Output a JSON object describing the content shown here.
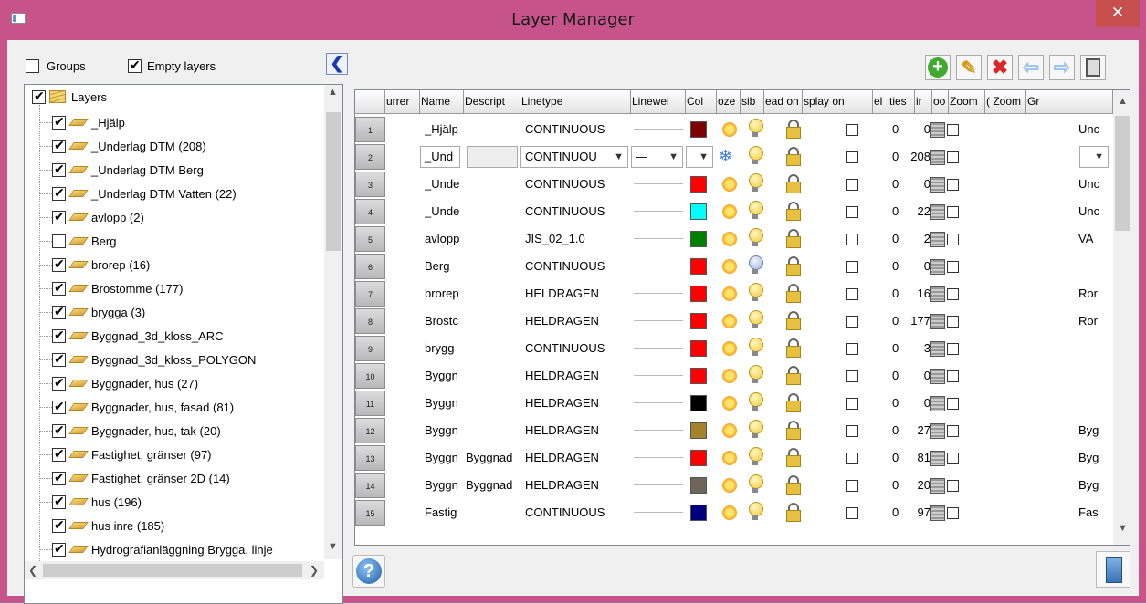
{
  "window": {
    "title": "Layer Manager",
    "close_label": "✕"
  },
  "options": {
    "groups_label": "Groups",
    "groups_checked": false,
    "empty_label": "Empty layers",
    "empty_checked": true,
    "collapse_label": "❮"
  },
  "tree": {
    "root_label": "Layers",
    "items": [
      {
        "label": "_Hjälp",
        "checked": true
      },
      {
        "label": "_Underlag DTM (208)",
        "checked": true
      },
      {
        "label": "_Underlag DTM Berg",
        "checked": true
      },
      {
        "label": "_Underlag DTM Vatten (22)",
        "checked": true
      },
      {
        "label": "avlopp (2)",
        "checked": true
      },
      {
        "label": "Berg",
        "checked": false
      },
      {
        "label": "brorep (16)",
        "checked": true
      },
      {
        "label": "Brostomme (177)",
        "checked": true
      },
      {
        "label": "brygga (3)",
        "checked": true
      },
      {
        "label": "Byggnad_3d_kloss_ARC",
        "checked": true
      },
      {
        "label": "Byggnad_3d_kloss_POLYGON",
        "checked": true
      },
      {
        "label": "Byggnader, hus (27)",
        "checked": true
      },
      {
        "label": "Byggnader, hus, fasad (81)",
        "checked": true
      },
      {
        "label": "Byggnader, hus, tak (20)",
        "checked": true
      },
      {
        "label": "Fastighet, gränser (97)",
        "checked": true
      },
      {
        "label": "Fastighet, gränser 2D (14)",
        "checked": true
      },
      {
        "label": "hus (196)",
        "checked": true
      },
      {
        "label": "hus inre (185)",
        "checked": true
      },
      {
        "label": "Hydrografianläggning Brygga, linje",
        "checked": true
      }
    ]
  },
  "toolbar": {
    "add": "add-layer",
    "edit": "edit-layer",
    "delete": "delete-layer",
    "prev": "previous",
    "next": "next",
    "close": "close-panel"
  },
  "grid": {
    "headers": [
      "urrer",
      "Name",
      "Descript",
      "Linetype",
      "Linewei",
      "Col",
      "oze",
      "sib",
      "ead on",
      "splay on",
      "el",
      "ties",
      "ir",
      "oo",
      "Zoom",
      "( Zoom",
      "Gr"
    ],
    "rows": [
      {
        "num": "1",
        "name": "_Hjälp",
        "desc": "",
        "linetype": "CONTINUOUS",
        "color": "#7f0000",
        "frozen": false,
        "visible": true,
        "elev": "0",
        "count": "0",
        "group": "Unc"
      },
      {
        "num": "2",
        "name": "_Und",
        "desc": "",
        "linetype": "CONTINUOU",
        "color": "",
        "frozen": true,
        "visible": true,
        "elev": "0",
        "count": "208",
        "group": "",
        "editing": true
      },
      {
        "num": "3",
        "name": "_Unde",
        "desc": "",
        "linetype": "CONTINUOUS",
        "color": "#ff0000",
        "frozen": false,
        "visible": true,
        "elev": "0",
        "count": "0",
        "group": "Unc"
      },
      {
        "num": "4",
        "name": "_Unde",
        "desc": "",
        "linetype": "CONTINUOUS",
        "color": "#00ffff",
        "frozen": false,
        "visible": true,
        "elev": "0",
        "count": "22",
        "group": "Unc"
      },
      {
        "num": "5",
        "name": "avlopp",
        "desc": "",
        "linetype": "JIS_02_1.0",
        "color": "#008000",
        "frozen": false,
        "visible": true,
        "elev": "0",
        "count": "2",
        "group": "VA"
      },
      {
        "num": "6",
        "name": "Berg",
        "desc": "",
        "linetype": "CONTINUOUS",
        "color": "#ff0000",
        "frozen": false,
        "visible": false,
        "elev": "0",
        "count": "0",
        "group": ""
      },
      {
        "num": "7",
        "name": "brorep",
        "desc": "",
        "linetype": "HELDRAGEN",
        "color": "#ff0000",
        "frozen": false,
        "visible": true,
        "elev": "0",
        "count": "16",
        "group": "Ror"
      },
      {
        "num": "8",
        "name": "Brostc",
        "desc": "",
        "linetype": "HELDRAGEN",
        "color": "#ff0000",
        "frozen": false,
        "visible": true,
        "elev": "0",
        "count": "177",
        "group": "Ror"
      },
      {
        "num": "9",
        "name": "brygg",
        "desc": "",
        "linetype": "CONTINUOUS",
        "color": "#ff0000",
        "frozen": false,
        "visible": true,
        "elev": "0",
        "count": "3",
        "group": ""
      },
      {
        "num": "10",
        "name": "Byggn",
        "desc": "",
        "linetype": "HELDRAGEN",
        "color": "#ff0000",
        "frozen": false,
        "visible": true,
        "elev": "0",
        "count": "0",
        "group": ""
      },
      {
        "num": "11",
        "name": "Byggn",
        "desc": "",
        "linetype": "HELDRAGEN",
        "color": "#000000",
        "frozen": false,
        "visible": true,
        "elev": "0",
        "count": "0",
        "group": ""
      },
      {
        "num": "12",
        "name": "Byggn",
        "desc": "",
        "linetype": "HELDRAGEN",
        "color": "#a5822a",
        "frozen": false,
        "visible": true,
        "elev": "0",
        "count": "27",
        "group": "Byg"
      },
      {
        "num": "13",
        "name": "Byggn",
        "desc": "Byggnad",
        "linetype": "HELDRAGEN",
        "color": "#ff0000",
        "frozen": false,
        "visible": true,
        "elev": "0",
        "count": "81",
        "group": "Byg"
      },
      {
        "num": "14",
        "name": "Byggn",
        "desc": "Byggnad",
        "linetype": "HELDRAGEN",
        "color": "#6e6658",
        "frozen": false,
        "visible": true,
        "elev": "0",
        "count": "20",
        "group": "Byg"
      },
      {
        "num": "15",
        "name": "Fastig",
        "desc": "",
        "linetype": "CONTINUOUS",
        "color": "#00007f",
        "frozen": false,
        "visible": true,
        "elev": "0",
        "count": "97",
        "group": "Fas"
      }
    ]
  },
  "footer": {
    "help_label": "?"
  }
}
